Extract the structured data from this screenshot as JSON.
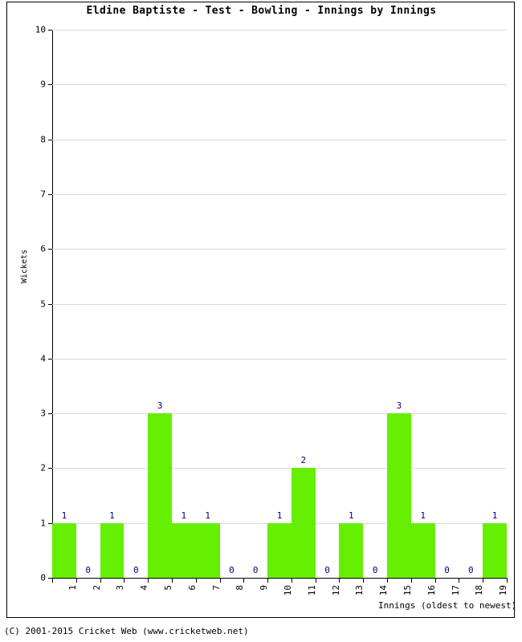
{
  "chart_data": {
    "type": "bar",
    "title": "Eldine Baptiste - Test - Bowling - Innings by Innings",
    "xlabel": "Innings (oldest to newest)",
    "ylabel": "Wickets",
    "categories": [
      "1",
      "2",
      "3",
      "4",
      "5",
      "6",
      "7",
      "8",
      "9",
      "10",
      "11",
      "12",
      "13",
      "14",
      "15",
      "16",
      "17",
      "18",
      "19"
    ],
    "values": [
      1,
      0,
      1,
      0,
      3,
      1,
      1,
      0,
      0,
      1,
      2,
      0,
      1,
      0,
      3,
      1,
      0,
      0,
      1
    ],
    "ylim": [
      0,
      10
    ],
    "ytick_labels": [
      "0",
      "1",
      "2",
      "3",
      "4",
      "5",
      "6",
      "7",
      "8",
      "9",
      "10"
    ],
    "grid": true,
    "legend": "none",
    "bar_color": "#66ee00",
    "label_color": "#000080",
    "show_value_labels": true
  },
  "footer": {
    "text": "(C) 2001-2015 Cricket Web (www.cricketweb.net)"
  }
}
